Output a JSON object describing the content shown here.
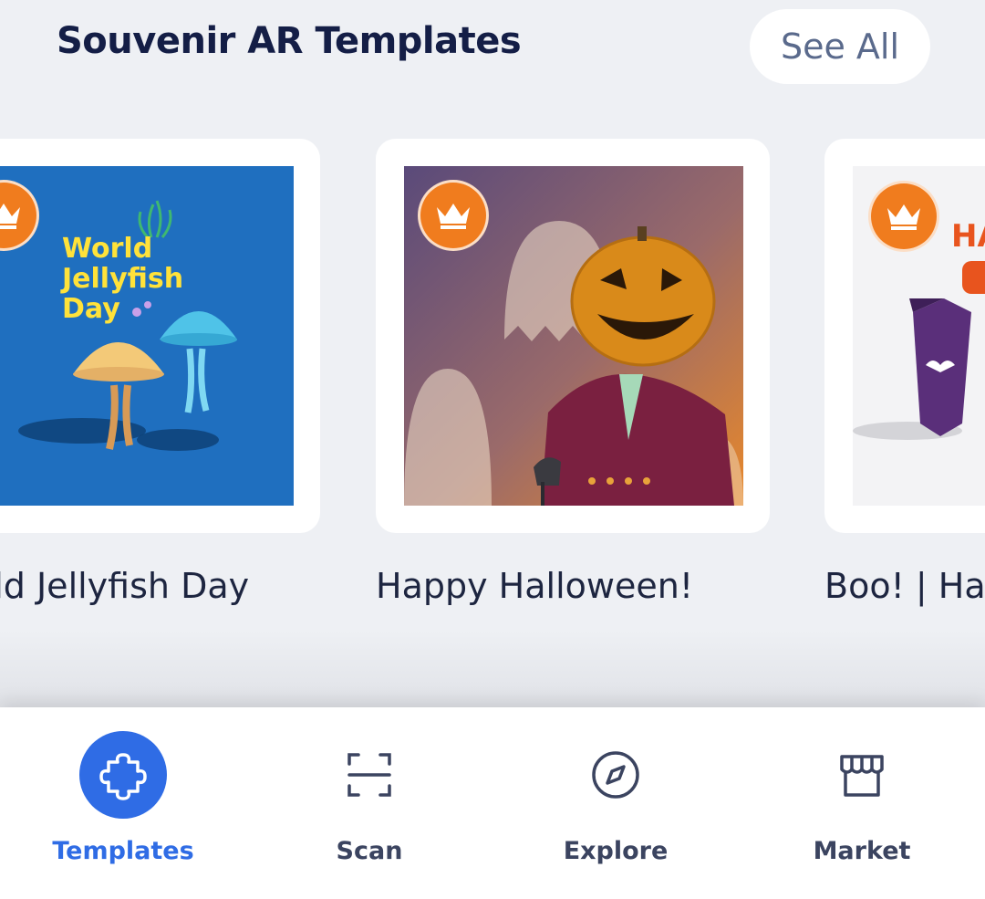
{
  "section": {
    "title": "Souvenir AR Templates",
    "see_all_label": "See All"
  },
  "cards": [
    {
      "label": "World Jellyfish Day",
      "art_text_lines": [
        "World",
        "Jellyfish",
        "Day"
      ],
      "premium": true
    },
    {
      "label": "Happy Halloween!",
      "premium": true
    },
    {
      "label": "Boo! | Halloween",
      "art_text": "HA",
      "premium": true
    }
  ],
  "colors": {
    "accent": "#2f6ce5",
    "premium_badge": "#f07c1e",
    "title_text": "#141e46"
  },
  "bottom_nav": {
    "items": [
      {
        "label": "Templates",
        "icon": "puzzle-icon",
        "active": true
      },
      {
        "label": "Scan",
        "icon": "scan-icon",
        "active": false
      },
      {
        "label": "Explore",
        "icon": "compass-icon",
        "active": false
      },
      {
        "label": "Market",
        "icon": "storefront-icon",
        "active": false
      }
    ]
  }
}
